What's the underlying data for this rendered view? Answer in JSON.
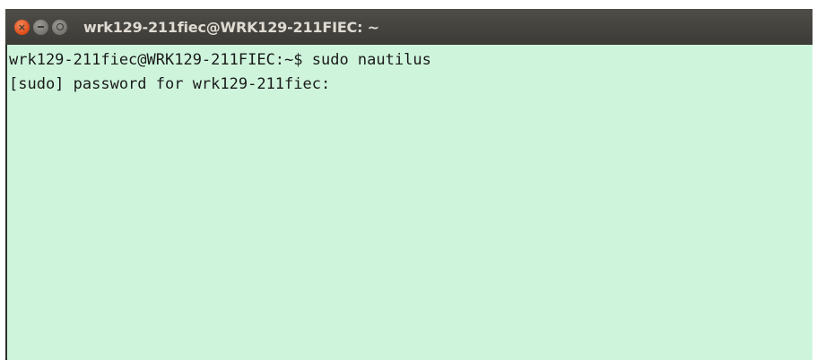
{
  "window": {
    "title": "wrk129-211fiec@WRK129-211FIEC: ~"
  },
  "controls": {
    "close_icon": "close-icon",
    "minimize_icon": "minimize-icon",
    "maximize_icon": "maximize-icon",
    "close_color": "#df4a16"
  },
  "terminal": {
    "background": "#cef5dc",
    "lines": [
      "wrk129-211fiec@WRK129-211FIEC:~$ sudo nautilus",
      "[sudo] password for wrk129-211fiec:"
    ]
  }
}
